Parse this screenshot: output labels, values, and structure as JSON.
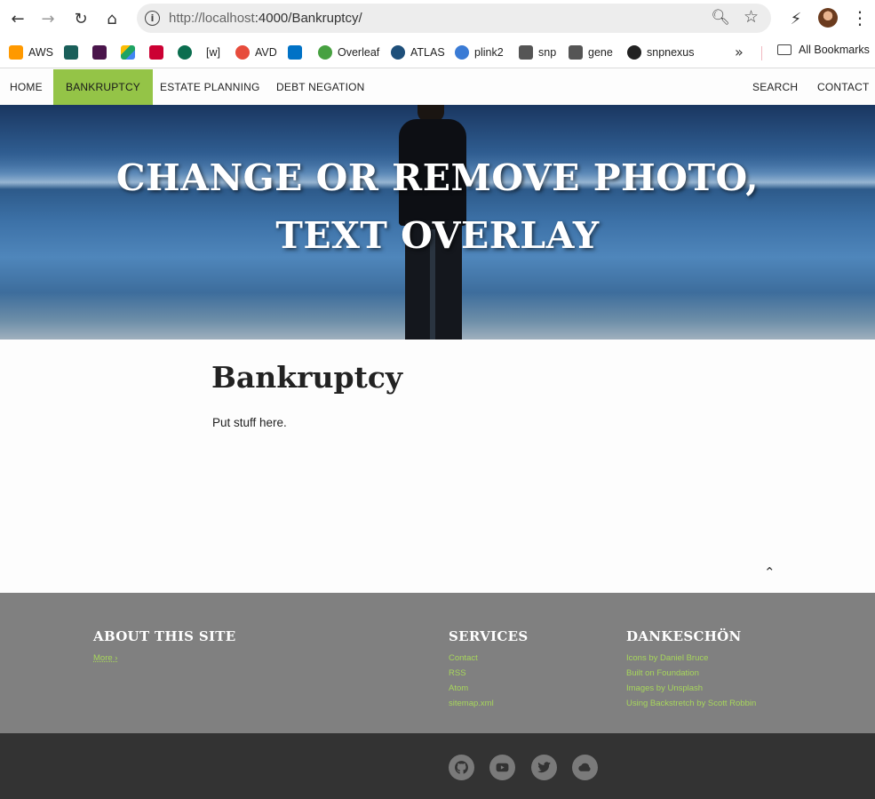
{
  "browser": {
    "url_scheme_host": "http://localhost",
    "url_rest": ":4000/Bankruptcy/",
    "bookmarks": [
      {
        "label": "AWS",
        "color": "#ff9900"
      },
      {
        "label": "",
        "color": "#1a5f5a"
      },
      {
        "label": "",
        "color": "#4a154b"
      },
      {
        "label": "",
        "color": "#1fa463"
      },
      {
        "label": "",
        "color": "#cc0033"
      },
      {
        "label": "",
        "color": "#0b6e4f"
      },
      {
        "label": "[w]",
        "color": ""
      },
      {
        "label": "AVD",
        "color": "#e74c3c"
      },
      {
        "label": "",
        "color": "#0072c6"
      },
      {
        "label": "Overleaf",
        "color": "#47a141"
      },
      {
        "label": "ATLAS",
        "color": "#1e4f7a"
      },
      {
        "label": "plink2",
        "color": "#3a7bd5"
      },
      {
        "label": "snp",
        "color": "#555555"
      },
      {
        "label": "gene",
        "color": "#555555"
      },
      {
        "label": "snpnexus",
        "color": "#222222"
      }
    ],
    "all_bookmarks": "All Bookmarks"
  },
  "nav": {
    "home": "HOME",
    "bankruptcy": "BANKRUPTCY",
    "estate": "ESTATE PLANNING",
    "debt": "DEBT NEGATION",
    "search": "SEARCH",
    "contact": "CONTACT"
  },
  "hero": {
    "title": "CHANGE OR REMOVE PHOTO, TEXT OVERLAY"
  },
  "main": {
    "heading": "Bankruptcy",
    "body": "Put stuff here."
  },
  "footer": {
    "about": {
      "title": "ABOUT THIS SITE",
      "link": "More ›"
    },
    "services": {
      "title": "SERVICES",
      "links": [
        "Contact",
        "RSS",
        "Atom",
        "sitemap.xml"
      ]
    },
    "thanks": {
      "title": "DANKESCHÖN",
      "links": [
        "Icons by Daniel Bruce",
        "Built on Foundation",
        "Images by Unsplash",
        "Using Backstretch by Scott Robbin"
      ]
    }
  },
  "colors": {
    "accent": "#94c447",
    "footer_bg": "#808080",
    "subfooter_bg": "#333333"
  }
}
